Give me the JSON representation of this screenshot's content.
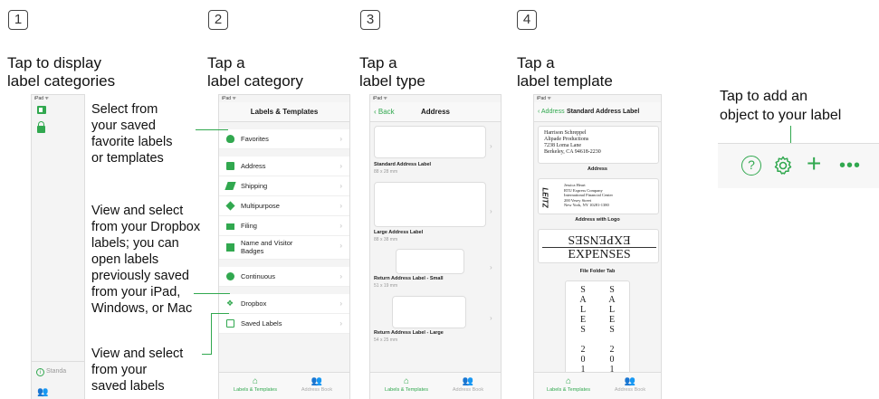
{
  "steps": [
    {
      "num": "1",
      "title_line1": "Tap to display",
      "title_line2": "label categories"
    },
    {
      "num": "2",
      "title_line1": "Tap a",
      "title_line2": "label category"
    },
    {
      "num": "3",
      "title_line1": "Tap a",
      "title_line2": "label type"
    },
    {
      "num": "4",
      "title_line1": "Tap a",
      "title_line2": "label template"
    }
  ],
  "status_label": "iPad",
  "screen1": {
    "bottom_text": "Standa"
  },
  "screen2": {
    "nav_title": "Labels & Templates",
    "rows": [
      {
        "label": "Favorites",
        "icon": "heart-icon"
      },
      {
        "label": "Address",
        "icon": "address-icon"
      },
      {
        "label": "Shipping",
        "icon": "shipping-icon"
      },
      {
        "label": "Multipurpose",
        "icon": "multipurpose-icon"
      },
      {
        "label": "Filing",
        "icon": "folder-icon"
      },
      {
        "label": "Name and Visitor",
        "label2": "Badges",
        "icon": "badge-icon"
      },
      {
        "label": "Continuous",
        "icon": "continuous-icon"
      },
      {
        "label": "Dropbox",
        "icon": "dropbox-icon"
      },
      {
        "label": "Saved Labels",
        "icon": "saved-icon"
      }
    ]
  },
  "screen3": {
    "back": "Back",
    "nav_title": "Address",
    "types": [
      {
        "name": "Standard Address Label",
        "size": "88 x 28 mm"
      },
      {
        "name": "Large Address Label",
        "size": "88 x 38 mm"
      },
      {
        "name": "Return Address Label - Small",
        "size": "51 x 19 mm"
      },
      {
        "name": "Return Address Label - Large",
        "size": "54 x 25 mm"
      }
    ]
  },
  "screen4": {
    "back": "Address",
    "nav_title": "Standard Address Label",
    "address_lines": [
      "Harrison Schreppel",
      "Alipade Productions",
      "7238 Loma Lane",
      "Berkeley, CA 94618-2230"
    ],
    "caption1": "Address",
    "logo_text": "LEITZ",
    "logo_lines": [
      "Jessica Heart",
      "RTU Express Company",
      "International Financial Center",
      "200 Vesey Street",
      "New York, NY 10281-1380"
    ],
    "caption2": "Address with Logo",
    "expenses_mirrored": "EXPENSES",
    "expenses": "EXPENSES",
    "caption3": "File Folder Tab",
    "vertical_col1": [
      "S",
      "A",
      "L",
      "E",
      "S",
      "",
      "2",
      "0",
      "1"
    ],
    "vertical_col2": [
      "S",
      "A",
      "L",
      "E",
      "S",
      "",
      "2",
      "0",
      "1"
    ]
  },
  "tabs": {
    "labels_templates": "Labels & Templates",
    "address_book": "Address Book"
  },
  "callouts": {
    "favorites": [
      "Select from",
      "your saved",
      "favorite labels",
      "or templates"
    ],
    "dropbox": [
      "View and select",
      "from your Dropbox",
      "labels; you can",
      "open labels",
      "previously saved",
      "from your iPad,",
      "Windows, or Mac"
    ],
    "saved": [
      "View and select",
      "from your",
      "saved labels"
    ],
    "toolbar": [
      "Tap to add an",
      "object to your label"
    ]
  },
  "colors": {
    "accent": "#31a84f"
  }
}
